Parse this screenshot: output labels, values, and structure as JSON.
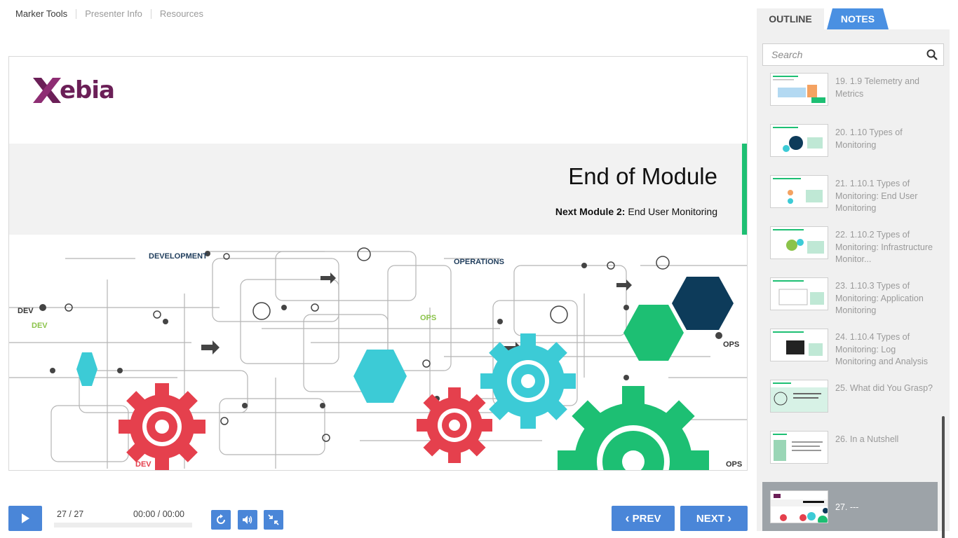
{
  "topnav": {
    "items": [
      "Marker Tools",
      "Presenter Info",
      "Resources"
    ]
  },
  "slide": {
    "logo_text": "ebia",
    "title": "End of Module",
    "next_label": "Next Module 2:",
    "next_value": "End User Monitoring",
    "graphic_labels": {
      "development": "DEVELOPMENT",
      "operations": "OPERATIONS",
      "dev1": "DEV",
      "dev2": "DEV",
      "ops1": "OPS",
      "ops2": "OPS",
      "ops3": "OPS",
      "dev3": "DEV"
    }
  },
  "sidebar": {
    "tabs": [
      "OUTLINE",
      "NOTES"
    ],
    "active_tab": "NOTES",
    "search_placeholder": "Search",
    "items": [
      "19. 1.9 Telemetry and Metrics",
      "20. 1.10 Types of Monitoring",
      "21. 1.10.1 Types of Monitoring: End User Monitoring",
      "22. 1.10.2 Types of Monitoring: Infrastructure Monitor...",
      "23. 1.10.3 Types of Monitoring: Application Monitoring",
      "24. 1.10.4 Types of Monitoring: Log Monitoring and Analysis",
      "25. What did You Grasp?",
      "26. In a Nutshell",
      "27. ---"
    ],
    "active_index": 8
  },
  "player": {
    "counter": "27 / 27",
    "time": "00:00 / 00:00",
    "prev_label": "PREV",
    "next_label": "NEXT"
  },
  "colors": {
    "accent": "#4a86d8",
    "brand_purple": "#6b1f57",
    "green": "#1dbf73",
    "teal": "#3ccbd6",
    "red": "#e5404d",
    "navy": "#0d3b5a"
  }
}
